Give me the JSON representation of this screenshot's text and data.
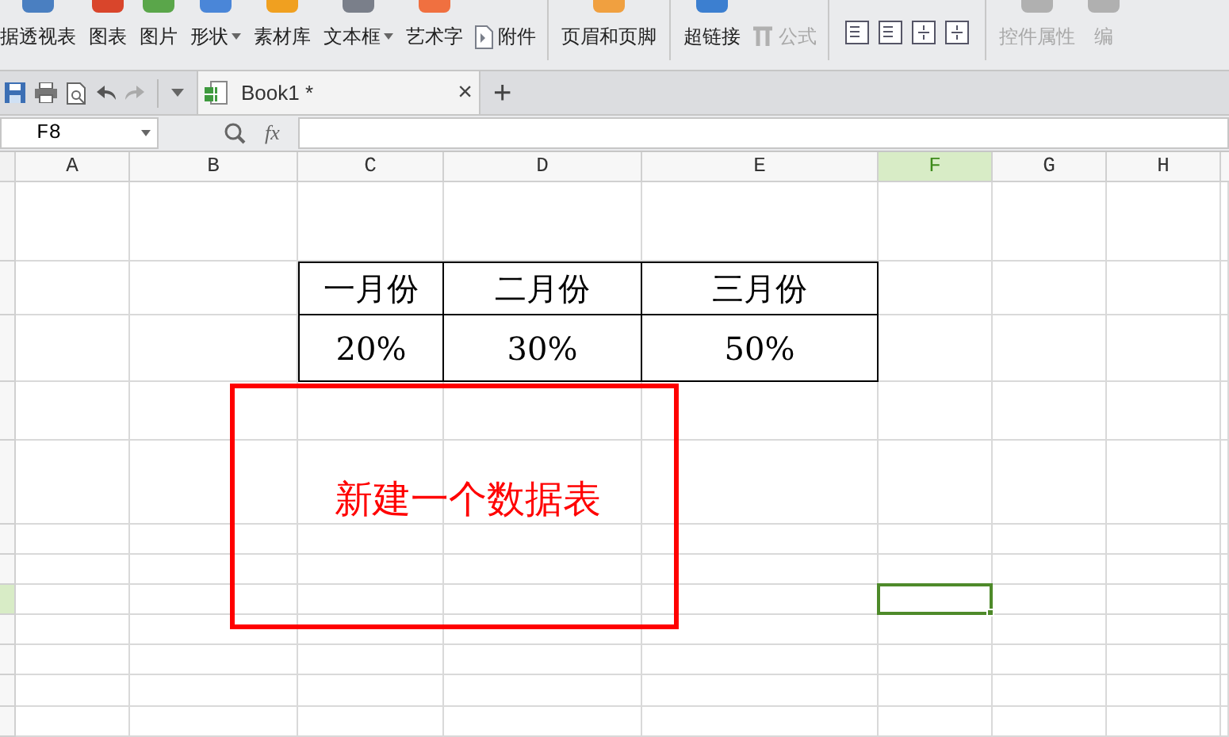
{
  "ribbon": [
    {
      "label": "据透视表",
      "kind": "large",
      "dropdown": false,
      "disabled": false
    },
    {
      "label": "图表",
      "kind": "large",
      "dropdown": false,
      "disabled": false
    },
    {
      "label": "图片",
      "kind": "large",
      "dropdown": false,
      "disabled": false
    },
    {
      "label": "形状",
      "kind": "large",
      "dropdown": true,
      "disabled": false
    },
    {
      "label": "素材库",
      "kind": "large",
      "dropdown": false,
      "disabled": false
    },
    {
      "label": "文本框",
      "kind": "large",
      "dropdown": true,
      "disabled": false
    },
    {
      "label": "艺术字",
      "kind": "large",
      "dropdown": false,
      "disabled": false
    },
    {
      "label": "附件",
      "kind": "inline",
      "dropdown": false,
      "disabled": false
    },
    {
      "kind": "separator"
    },
    {
      "label": "页眉和页脚",
      "kind": "large",
      "dropdown": false,
      "disabled": false
    },
    {
      "kind": "separator"
    },
    {
      "label": "超链接",
      "kind": "large",
      "dropdown": false,
      "disabled": false
    },
    {
      "label": "公式",
      "kind": "formula",
      "dropdown": false,
      "disabled": true
    },
    {
      "kind": "separator"
    },
    {
      "kind": "small-icons"
    },
    {
      "kind": "separator"
    },
    {
      "label": "控件属性",
      "kind": "large",
      "dropdown": false,
      "disabled": true
    },
    {
      "label": "编",
      "kind": "large",
      "dropdown": false,
      "disabled": true
    }
  ],
  "document_tab": {
    "title": "Book1 *",
    "close": "×",
    "new": "+"
  },
  "formula_bar": {
    "name_box": "F8",
    "fx": "fx"
  },
  "columns": [
    {
      "label": "A",
      "selected": false
    },
    {
      "label": "B",
      "selected": false
    },
    {
      "label": "C",
      "selected": false
    },
    {
      "label": "D",
      "selected": false
    },
    {
      "label": "E",
      "selected": false
    },
    {
      "label": "F",
      "selected": true
    },
    {
      "label": "G",
      "selected": false
    },
    {
      "label": "H",
      "selected": false
    }
  ],
  "rows": [
    {
      "selected": false
    },
    {
      "selected": false
    },
    {
      "selected": false
    },
    {
      "selected": false
    },
    {
      "selected": false
    },
    {
      "selected": false
    },
    {
      "selected": false
    },
    {
      "selected": true
    },
    {
      "selected": false
    },
    {
      "selected": false
    },
    {
      "selected": false
    },
    {
      "selected": false
    }
  ],
  "table": {
    "header": [
      "一月份",
      "二月份",
      "三月份"
    ],
    "values": [
      "20%",
      "30%",
      "50%"
    ]
  },
  "text_box": {
    "text": "新建一个数据表"
  }
}
